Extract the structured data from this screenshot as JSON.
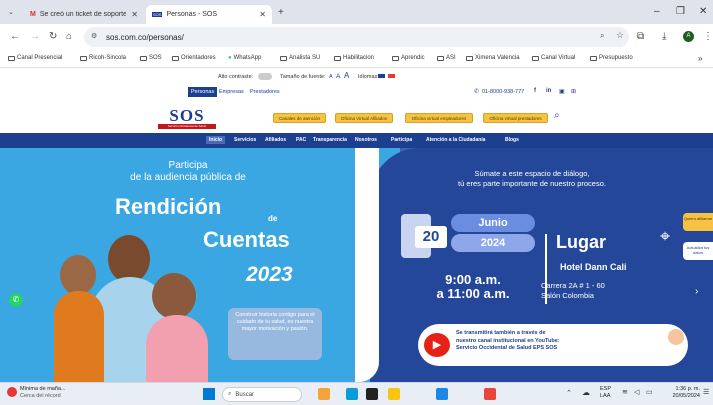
{
  "browser": {
    "tabs": [
      {
        "label": "Se creó un ticket de soporte c..."
      },
      {
        "label": "Personas - SOS"
      }
    ],
    "url": "sos.com.co/personas/",
    "bookmarks": [
      "Canal Presencial",
      "Ricoh-Sincola",
      "SOS",
      "Orientadores",
      "WhatsApp",
      "Analista SU",
      "Habilitacion",
      "Aprendic",
      "ASI",
      "Ximena Valencia",
      "Canal Virtual",
      "Presupuesto"
    ]
  },
  "topbar": {
    "contrast_label": "Alto contraste:",
    "font_size_label": "Tamaño de fuente:",
    "font_a_small": "A",
    "font_a_mid": "A",
    "font_a_big": "A",
    "languages_label": "Idiomas:"
  },
  "header": {
    "audience_tabs": [
      "Personas",
      "Empresas",
      "Prestadores"
    ],
    "phone": "01-8000-938-777",
    "social_f": "f",
    "social_in": "in",
    "logo_text": "SOS",
    "logo_sub": "Servicio Occidental de Salud",
    "quick_buttons": [
      "Canales de atención",
      "Oficina Virtual Afiliados",
      "Oficina virtual empleadores",
      "Oficina virtual prestadores"
    ]
  },
  "nav": {
    "items": [
      "Inicio",
      "Servicios",
      "Afiliados",
      "PAC",
      "Transparencia",
      "Nosotros",
      "Participa",
      "Atención a la Ciudadanía",
      "Blogs"
    ]
  },
  "hero": {
    "participa": "Participa",
    "audiencia": "de la audiencia pública de",
    "rendicion": "Rendición",
    "de": "de",
    "cuentas": "Cuentas",
    "year": "2023",
    "construir": "Construir historia contigo para el cuidado de tu salud, es nuestra mayor motivación y pasión.",
    "sumate1": "Súmate a este espacio de diálogo,",
    "sumate2": "tú eres parte importante de nuestro proceso.",
    "day": "20",
    "month": "Junio",
    "cal_year": "2024",
    "time1": "9:00 a.m.",
    "time2": "a 11:00 a.m.",
    "lugar": "Lugar",
    "hotel": "Hotel Dann Cali",
    "address1": "Carrera 2A # 1 - 60",
    "address2": "Salón Colombia",
    "stream1": "Se transmitirá también a través de",
    "stream2": "nuestro canal institucional en YouTube:",
    "stream3": "Servicio Occidental de Salud EPS SOS",
    "side1": "Quiero afiliarme",
    "side2": "Actualiza tus datos"
  },
  "taskbar": {
    "weather1": "Mínima de maña...",
    "weather2": "Cerca del récord",
    "search": "Buscar",
    "lang1": "ESP",
    "lang2": "LAA",
    "time": "1:36 p. m.",
    "date": "20/05/2024"
  }
}
